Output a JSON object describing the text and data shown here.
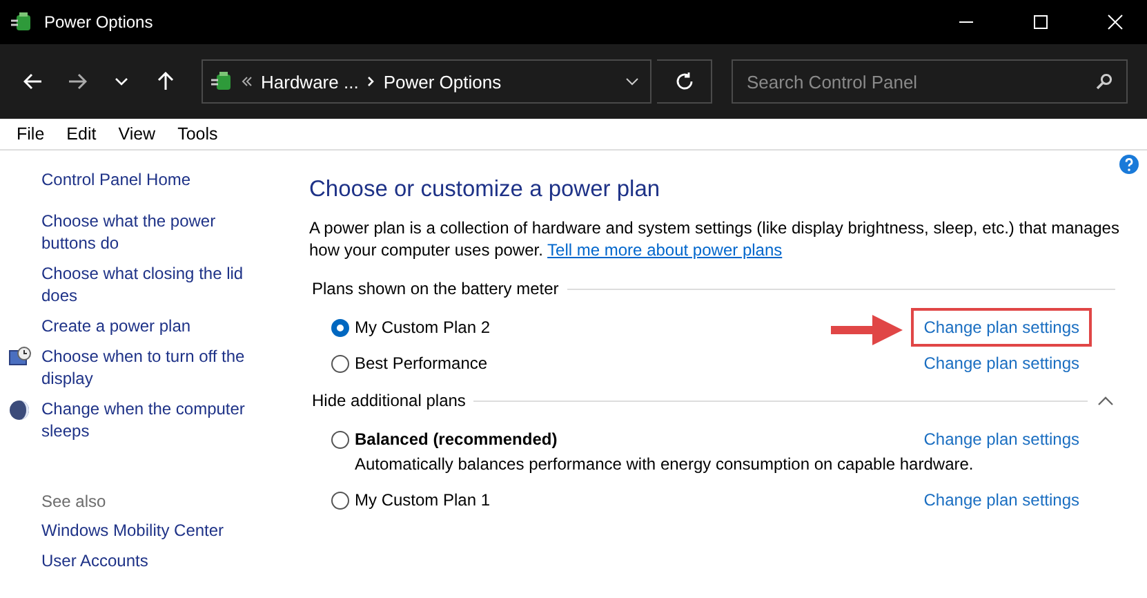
{
  "window": {
    "title": "Power Options"
  },
  "nav": {
    "breadcrumb": [
      "Hardware ...",
      "Power Options"
    ],
    "search_placeholder": "Search Control Panel"
  },
  "menu": [
    "File",
    "Edit",
    "View",
    "Tools"
  ],
  "sidebar": {
    "home": "Control Panel Home",
    "items": [
      {
        "label": "Choose what the power buttons do",
        "kind": "plain"
      },
      {
        "label": "Choose what closing the lid does",
        "kind": "plain"
      },
      {
        "label": "Create a power plan",
        "kind": "plain"
      },
      {
        "label": "Choose when to turn off the display",
        "kind": "display"
      },
      {
        "label": "Change when the computer sleeps",
        "kind": "sleep"
      }
    ],
    "see_also_title": "See also",
    "see_also": [
      "Windows Mobility Center",
      "User Accounts"
    ]
  },
  "main": {
    "heading": "Choose or customize a power plan",
    "description": "A power plan is a collection of hardware and system settings (like display brightness, sleep, etc.) that manages how your computer uses power.",
    "more_link": "Tell me more about power plans",
    "sections": [
      {
        "title": "Plans shown on the battery meter",
        "collapsible": false,
        "plans": [
          {
            "name": "My Custom Plan 2",
            "selected": true,
            "bold": false,
            "link": "Change plan settings",
            "highlighted": true
          },
          {
            "name": "Best Performance",
            "selected": false,
            "bold": false,
            "link": "Change plan settings",
            "highlighted": false
          }
        ]
      },
      {
        "title": "Hide additional plans",
        "collapsible": true,
        "plans": [
          {
            "name": "Balanced (recommended)",
            "selected": false,
            "bold": true,
            "description": "Automatically balances performance with energy consumption on capable hardware.",
            "link": "Change plan settings",
            "highlighted": false
          },
          {
            "name": "My Custom Plan 1",
            "selected": false,
            "bold": false,
            "link": "Change plan settings",
            "highlighted": false
          }
        ]
      }
    ]
  }
}
